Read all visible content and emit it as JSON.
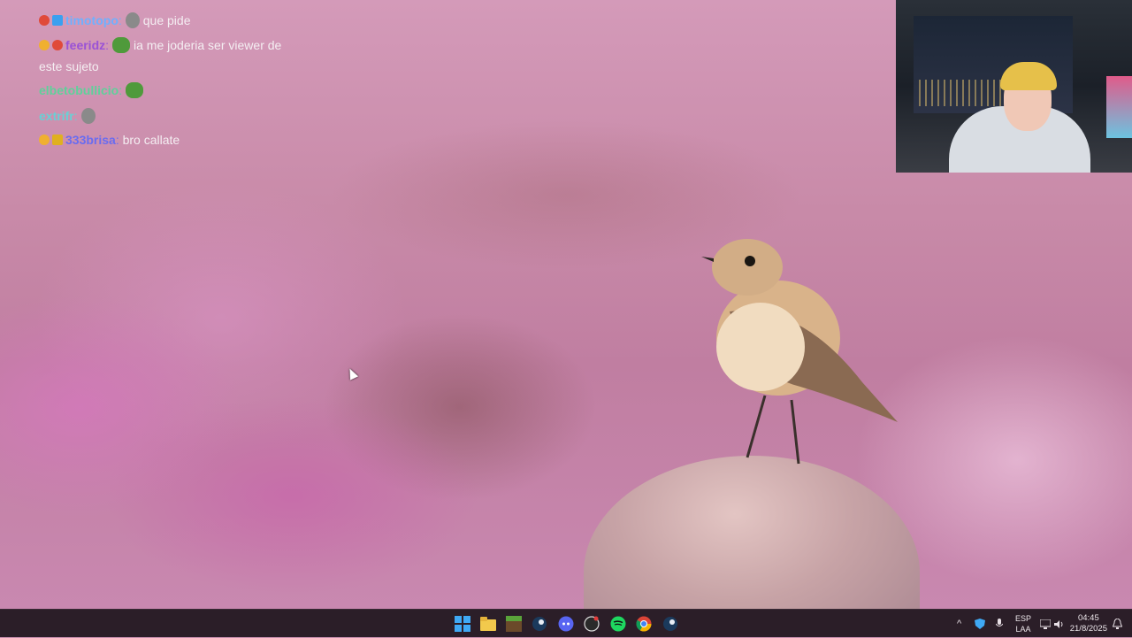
{
  "chat": {
    "messages": [
      {
        "user": "timotopo",
        "user_color": "#6fb0ff",
        "text": "que pide",
        "emote": "skull-emote"
      },
      {
        "user": "feeridz",
        "user_color": "#9a52d6",
        "text": "ia me joderia ser viewer de",
        "continuation": "este sujeto",
        "emote": "pepe-emote"
      },
      {
        "user": "elbetobullicio",
        "user_color": "#5fd19a",
        "text": "",
        "emote": "pepe-emote"
      },
      {
        "user": "extrifr",
        "user_color": "#6ad0d4",
        "text": "",
        "emote": "skull-emote"
      },
      {
        "user": "333brisa",
        "user_color": "#6a6cf0",
        "text": "bro callate"
      }
    ]
  },
  "taskbar": {
    "apps": [
      "windows-start-icon",
      "file-explorer-icon",
      "minecraft-icon",
      "steam-icon",
      "discord-icon",
      "obs-icon",
      "spotify-icon",
      "chrome-icon",
      "steam-icon-2"
    ],
    "tray": {
      "lang_top": "ESP",
      "lang_bottom": "LAA",
      "time": "04:45",
      "date": "21/8/2025"
    }
  },
  "colors": {
    "taskbar": "#2b1e28",
    "spotify": "#1ed760",
    "discord": "#5865f2",
    "windows": "#3fa9f5"
  }
}
